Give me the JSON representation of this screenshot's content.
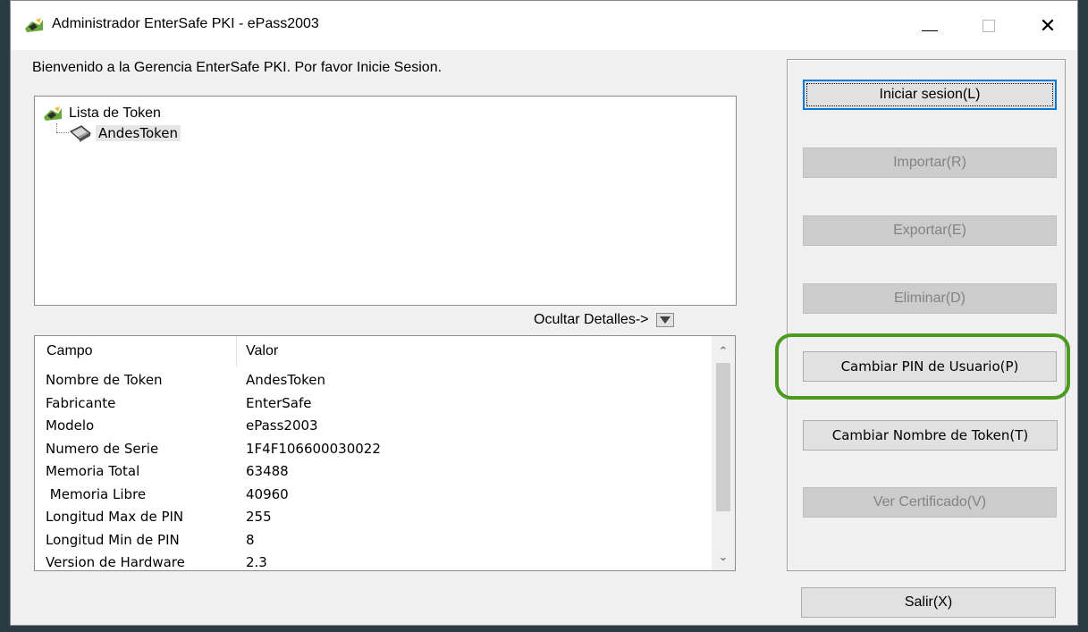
{
  "window": {
    "title": "Administrador EnterSafe PKI  - ePass2003",
    "controls": {
      "close": "✕"
    }
  },
  "welcome": "Bienvenido a la Gerencia EnterSafe PKI. Por favor Inicie Sesion.",
  "tree": {
    "root_label": "Lista de Token",
    "child_label": "AndesToken"
  },
  "details_toggle": "Ocultar Detalles->",
  "details": {
    "headers": [
      "Campo",
      "Valor"
    ],
    "rows": [
      {
        "field": "Nombre de Token",
        "value": "AndesToken"
      },
      {
        "field": "Fabricante",
        "value": "EnterSafe"
      },
      {
        "field": "Modelo",
        "value": "ePass2003"
      },
      {
        "field": "Numero de Serie",
        "value": "1F4F106600030022"
      },
      {
        "field": "Memoria Total",
        "value": "63488"
      },
      {
        "field": " Memoria Libre",
        "value": "40960"
      },
      {
        "field": "Longitud Max de PIN",
        "value": "255"
      },
      {
        "field": "Longitud Min de PIN",
        "value": "8"
      },
      {
        "field": "Version de Hardware",
        "value": "2.3"
      }
    ]
  },
  "buttons": {
    "login": "Iniciar sesion(L)",
    "import": "Importar(R)",
    "export": "Exportar(E)",
    "delete": "Eliminar(D)",
    "change_pin": "Cambiar PIN de Usuario(P)",
    "rename_token": "Cambiar Nombre de Token(T)",
    "view_cert": "Ver Certificado(V)",
    "exit": "Salir(X)"
  },
  "colors": {
    "highlight": "#4a9b1f",
    "focus": "#0078d7"
  }
}
